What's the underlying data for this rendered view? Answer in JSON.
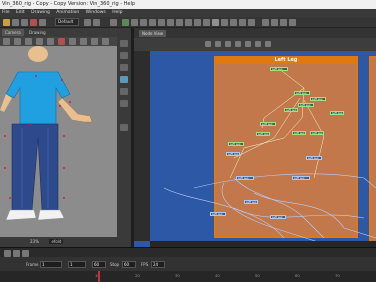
{
  "window": {
    "title": "Vin_360_rig - Copy - Copy Version: Vin_360_rig - Help"
  },
  "menu": {
    "items": [
      "File",
      "Edit",
      "Drawing",
      "Animation",
      "Windows",
      "Help"
    ]
  },
  "toolbar": {
    "preset": "Default"
  },
  "camera_view": {
    "tabs": [
      "Camera",
      "Drawing"
    ],
    "status": {
      "zoom": "23%",
      "mode": "efold"
    }
  },
  "node_view": {
    "tab": "Node View",
    "group_title": "Left Leg",
    "nodes": [
      {
        "label": "Left Leg",
        "style": "green"
      },
      {
        "label": "Left Leg",
        "style": "green"
      },
      {
        "label": "Left Leg",
        "style": "green"
      },
      {
        "label": "Left Leg",
        "style": "green"
      },
      {
        "label": "Left Leg",
        "style": "green"
      },
      {
        "label": "Left Leg",
        "style": "green"
      },
      {
        "label": "Left Leg",
        "style": "green"
      },
      {
        "label": "Left Leg",
        "style": "green"
      },
      {
        "label": "Left Leg",
        "style": "green"
      },
      {
        "label": "Left Leg",
        "style": "green"
      },
      {
        "label": "Left Leg",
        "style": "green"
      },
      {
        "label": "Left Leg",
        "style": "blue"
      },
      {
        "label": "Left Leg",
        "style": "blue"
      },
      {
        "label": "Left Leg",
        "style": "blue"
      },
      {
        "label": "Left Leg",
        "style": "blue"
      },
      {
        "label": "Left Leg",
        "style": "blue"
      },
      {
        "label": "Left Leg",
        "style": "blue"
      },
      {
        "label": "Left Leg",
        "style": "blue"
      }
    ]
  },
  "timeline": {
    "fields": [
      {
        "label": "Frame",
        "value": "1"
      },
      {
        "label": "",
        "value": "1"
      },
      {
        "label": "",
        "value": "60"
      },
      {
        "label": "Stop",
        "value": "60"
      },
      {
        "label": "FPS",
        "value": "24"
      }
    ],
    "ticks": [
      "10",
      "20",
      "30",
      "40",
      "50",
      "60",
      "70"
    ]
  },
  "colors": {
    "node_view_bg": "#2d58a6",
    "group_fill": "#c2784a",
    "group_border": "#e07a10",
    "character_shirt": "#20a0e0",
    "character_pants": "#2e4a8c",
    "playhead": "#d03030"
  }
}
